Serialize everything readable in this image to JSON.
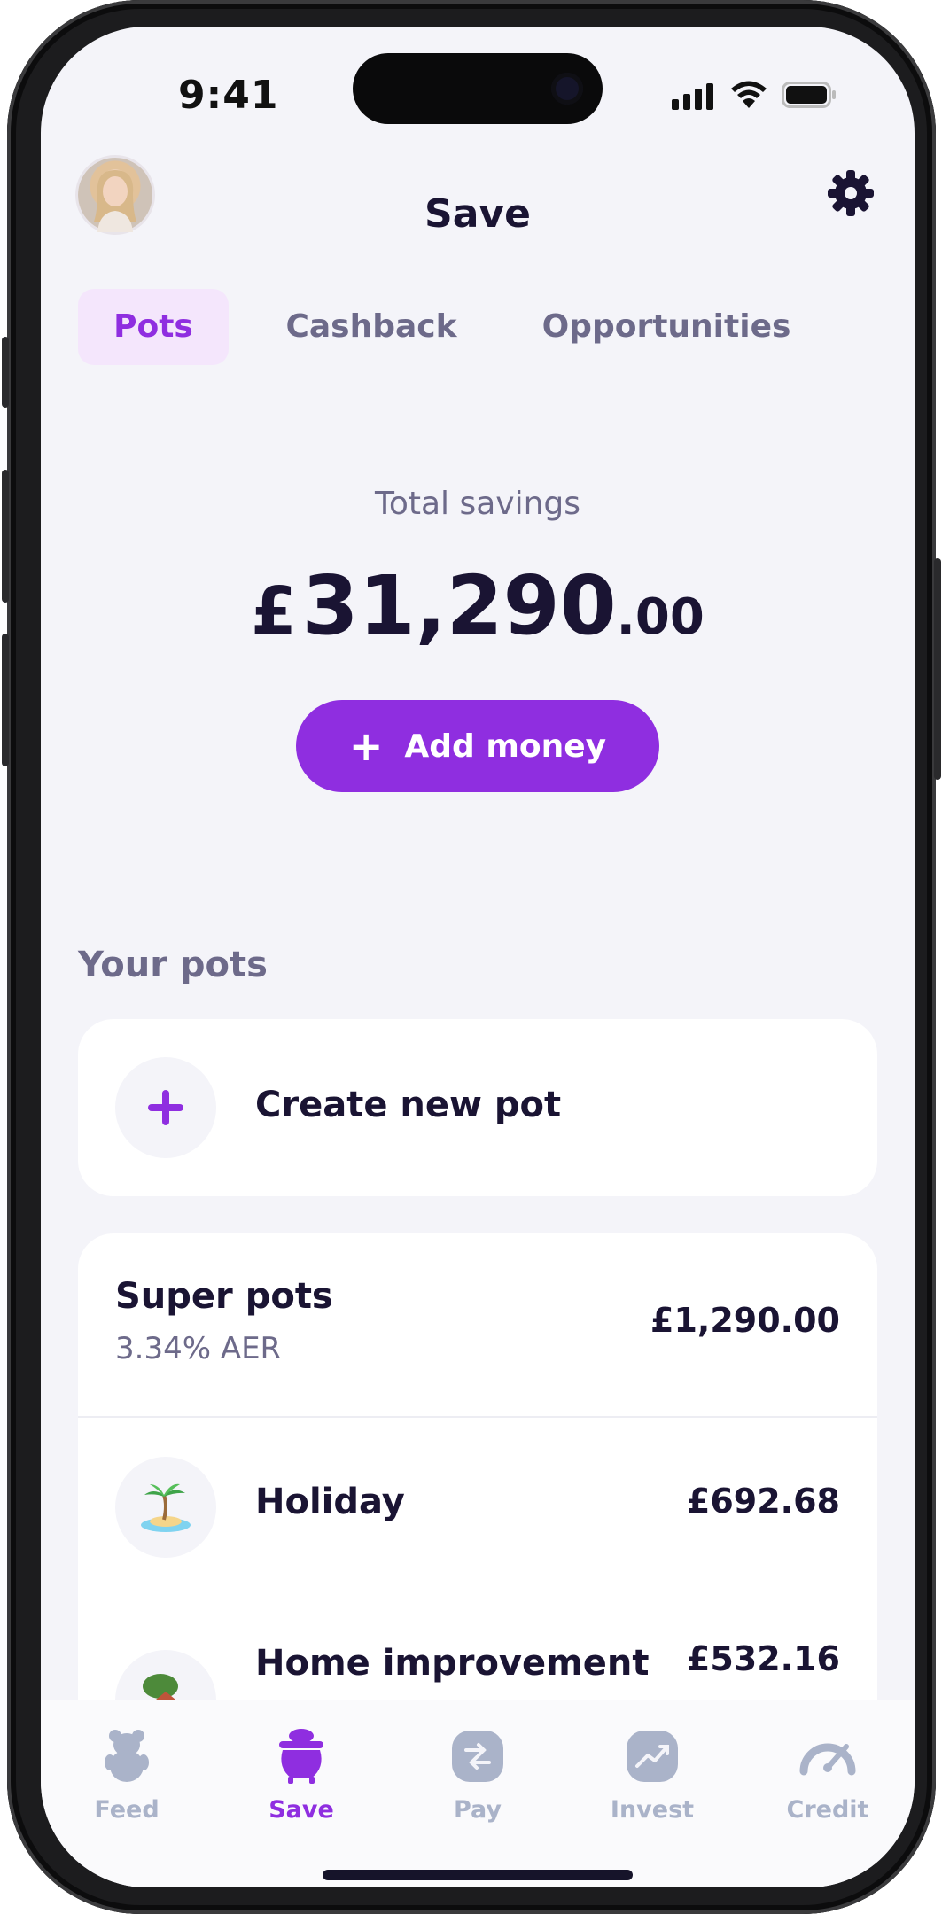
{
  "status_bar": {
    "time": "9:41"
  },
  "header": {
    "title": "Save",
    "avatar_icon": "avatar",
    "settings_icon": "gear-icon"
  },
  "tabs": [
    {
      "label": "Pots",
      "active": true
    },
    {
      "label": "Cashback",
      "active": false
    },
    {
      "label": "Opportunities",
      "active": false
    }
  ],
  "summary": {
    "label": "Total savings",
    "currency": "£",
    "amount_major": "31,290",
    "amount_minor": ".00",
    "add_button": {
      "icon": "plus-icon",
      "label": "Add money"
    }
  },
  "pots_section": {
    "title": "Your pots",
    "create": {
      "icon": "plus-icon",
      "label": "Create new pot"
    },
    "super_pots": {
      "label": "Super pots",
      "rate": "3.34% AER",
      "amount": "£1,290.00"
    },
    "items": [
      {
        "label": "Holiday",
        "amount": "£692.68",
        "icon": "palm-island-icon"
      },
      {
        "label": "Home improvement",
        "amount": "£532.16",
        "icon": "house-icon"
      }
    ]
  },
  "tab_bar": [
    {
      "label": "Feed",
      "icon": "bear-icon",
      "active": false
    },
    {
      "label": "Save",
      "icon": "pot-icon",
      "active": true
    },
    {
      "label": "Pay",
      "icon": "pay-icon",
      "active": false
    },
    {
      "label": "Invest",
      "icon": "chart-up-icon",
      "active": false
    },
    {
      "label": "Credit",
      "icon": "gauge-icon",
      "active": false
    }
  ],
  "colors": {
    "accent": "#8F2EE0",
    "accent_soft": "#F4E6FC",
    "text_primary": "#1A1433",
    "text_secondary": "#6D6A8A",
    "background": "#F4F4F9",
    "inactive_icon": "#AAB3C9"
  }
}
